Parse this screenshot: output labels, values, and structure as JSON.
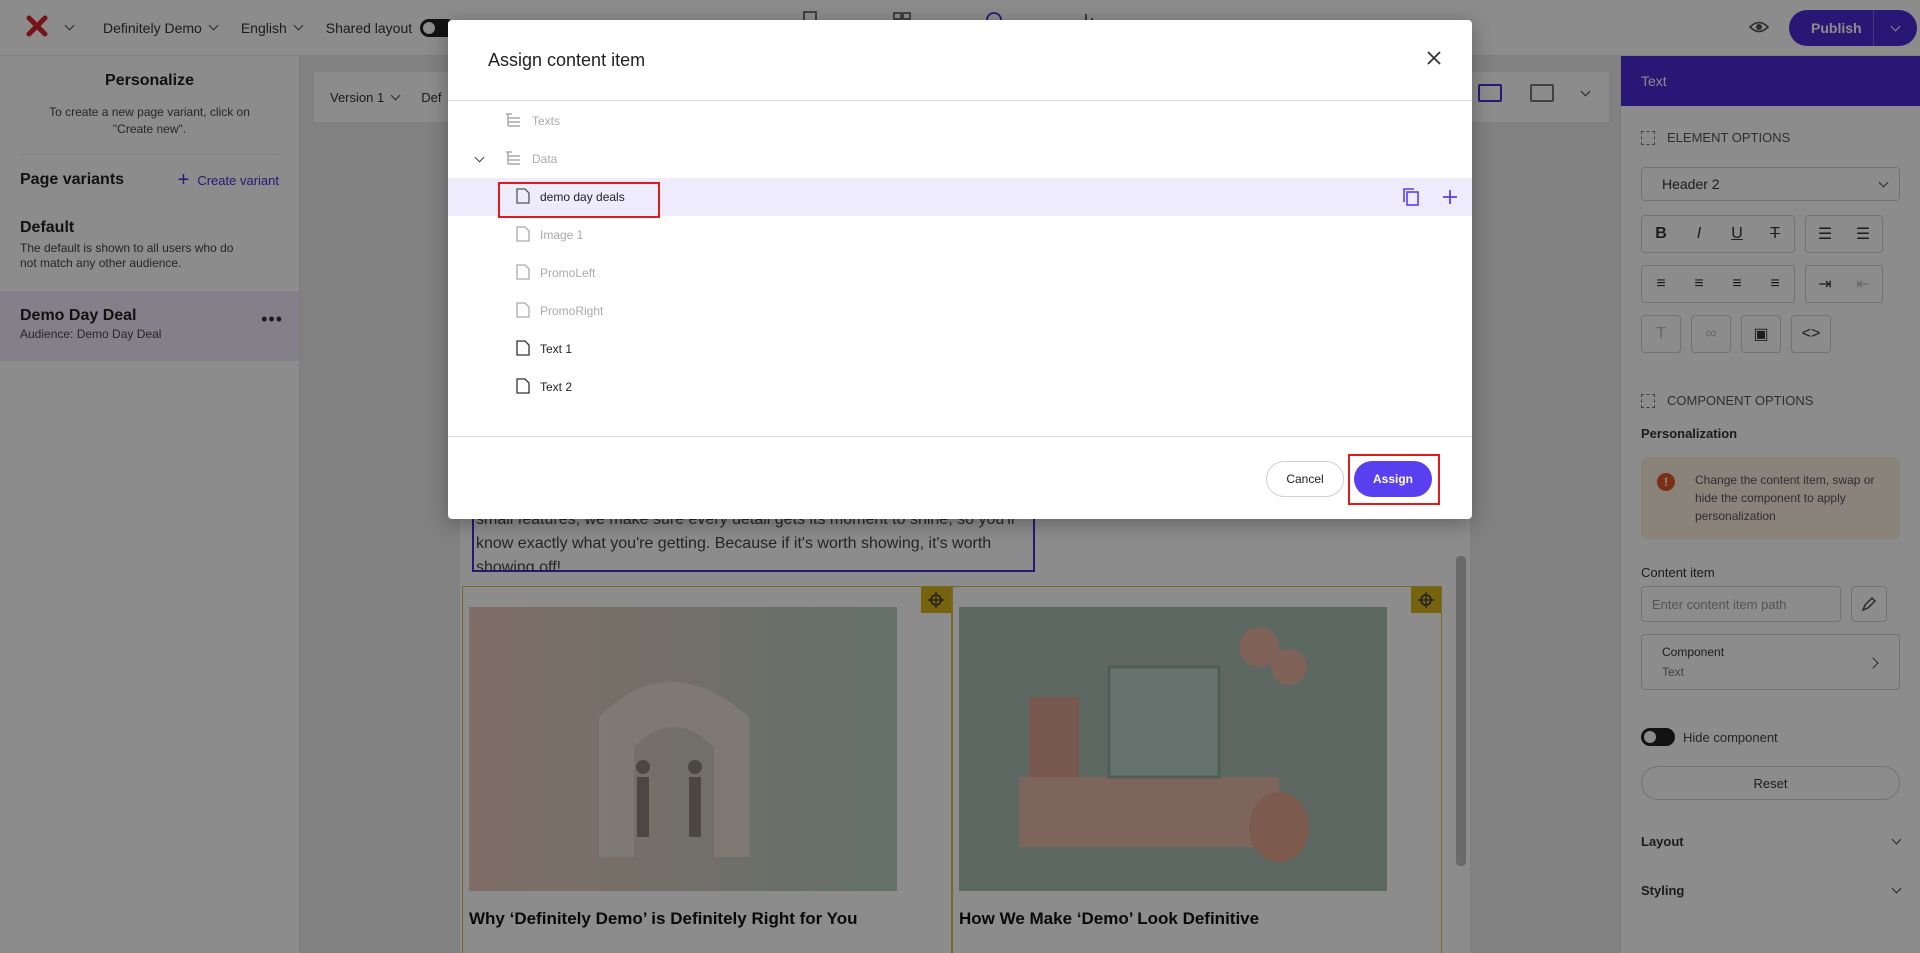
{
  "topbar": {
    "site": "Definitely Demo",
    "language": "English",
    "shared_layout_label": "Shared layout",
    "publish_label": "Publish"
  },
  "left_panel": {
    "title": "Personalize",
    "hint": "To create a new page variant, click on \"Create new\".",
    "variants_title": "Page variants",
    "create_variant_label": "Create variant",
    "variants": [
      {
        "name": "Default",
        "description": "The default is shown to all users who do not match any other audience."
      },
      {
        "name": "Demo Day Deal",
        "description": "Audience: Demo Day Deal"
      }
    ]
  },
  "canvas": {
    "version_label": "Version 1",
    "default_label_partial": "Def",
    "text_block": "small features, we make sure every detail gets its moment to shine, so you'll know exactly what you're getting. Because if it's worth showing, it's worth showing off!",
    "cards": [
      {
        "title": "Why ‘Definitely Demo’ is Definitely Right for You"
      },
      {
        "title": "How We Make ‘Demo’ Look Definitive"
      }
    ]
  },
  "right_panel": {
    "header": "Text",
    "element_options_label": "ELEMENT OPTIONS",
    "heading_select_value": "Header 2",
    "component_options_label": "COMPONENT OPTIONS",
    "personalization_label": "Personalization",
    "warning_text": "Change the content item, swap or hide the component to apply personalization",
    "content_item_label": "Content item",
    "content_item_placeholder": "Enter content item path",
    "component_title": "Component",
    "component_value": "Text",
    "hide_component_label": "Hide component",
    "reset_label": "Reset",
    "layout_label": "Layout",
    "styling_label": "Styling"
  },
  "modal": {
    "title": "Assign content item",
    "tree": [
      {
        "label": "Texts",
        "type": "folder",
        "state": "dim"
      },
      {
        "label": "Data",
        "type": "folder",
        "state": "dim"
      },
      {
        "label": "demo day deals",
        "type": "item",
        "state": "selected"
      },
      {
        "label": "Image 1",
        "type": "item",
        "state": "dim"
      },
      {
        "label": "PromoLeft",
        "type": "item",
        "state": "dim"
      },
      {
        "label": "PromoRight",
        "type": "item",
        "state": "dim"
      },
      {
        "label": "Text 1",
        "type": "item",
        "state": "normal"
      },
      {
        "label": "Text 2",
        "type": "item",
        "state": "normal"
      }
    ],
    "cancel_label": "Cancel",
    "assign_label": "Assign"
  },
  "colors": {
    "accent": "#4a2bd6",
    "assign_button": "#5a3ff0",
    "highlight": "#e01b1b",
    "selected_row": "#eeebfd",
    "warning_bg": "#fbeede"
  }
}
